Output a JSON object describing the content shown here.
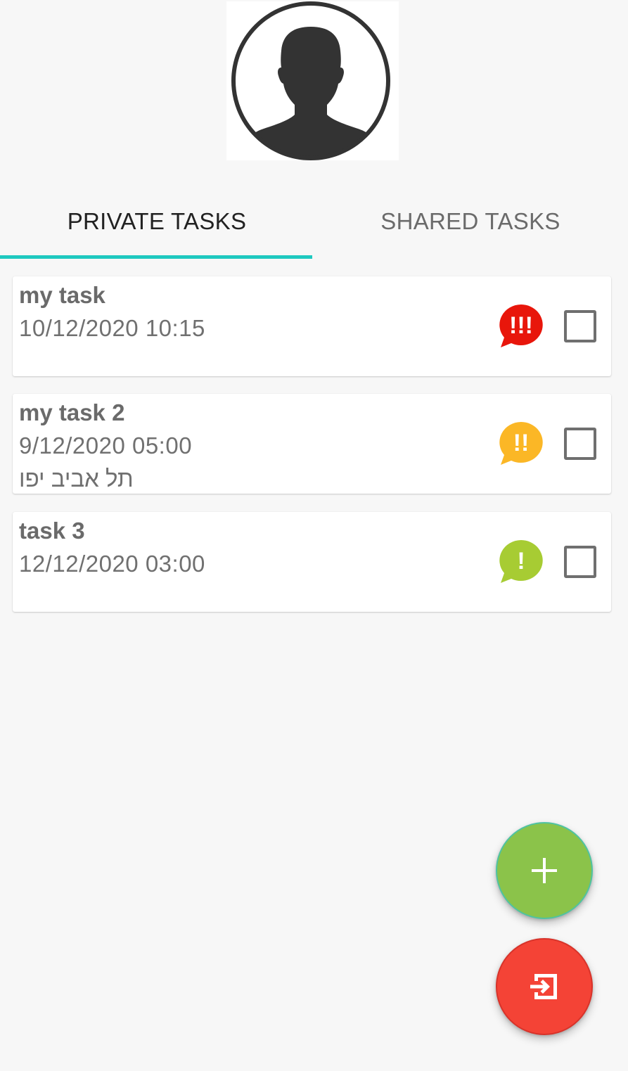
{
  "profile": {
    "avatar_icon": "person-silhouette-icon"
  },
  "tabs": [
    {
      "label": "PRIVATE TASKS",
      "selected": true
    },
    {
      "label": "SHARED TASKS",
      "selected": false
    }
  ],
  "colors": {
    "tab_indicator": "#1ec9c0",
    "priority_high": "#e8160b",
    "priority_medium": "#fbb726",
    "priority_low": "#a7cc33",
    "fab_add": "#8bc34a",
    "fab_logout": "#f44336"
  },
  "tasks": [
    {
      "title": "my task",
      "datetime": "10/12/2020 10:15",
      "location": "",
      "priority": "high",
      "priority_mark": "!!!",
      "priority_icon": "high-priority-speech-bubble-icon",
      "checked": false
    },
    {
      "title": "my task 2",
      "datetime": "9/12/2020 05:00",
      "location": "תל אביב יפו",
      "priority": "medium",
      "priority_mark": "!!",
      "priority_icon": "medium-priority-speech-bubble-icon",
      "checked": false
    },
    {
      "title": "task 3",
      "datetime": "12/12/2020 03:00",
      "location": "",
      "priority": "low",
      "priority_mark": "!",
      "priority_icon": "low-priority-speech-bubble-icon",
      "checked": false
    }
  ],
  "actions": {
    "add_icon": "plus-icon",
    "logout_icon": "exit-icon"
  }
}
